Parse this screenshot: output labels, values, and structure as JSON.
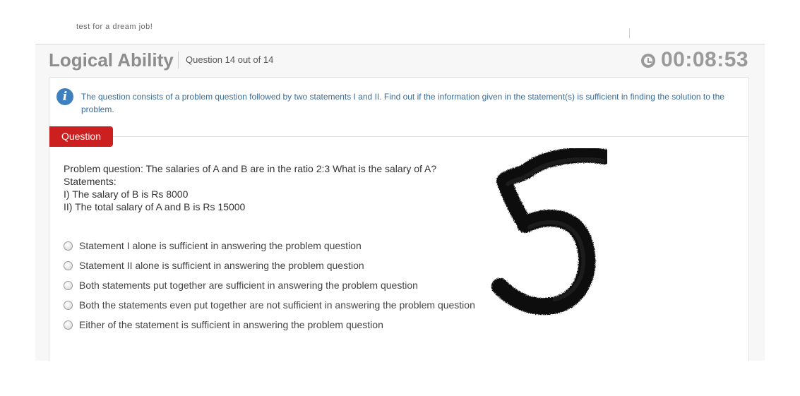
{
  "top_strip": {
    "cut_text": "test for a dream job!"
  },
  "header": {
    "section_title": "Logical Ability",
    "question_counter": "Question 14 out of 14",
    "timer": "00:08:53",
    "clock_icon": "clock-icon"
  },
  "info": {
    "icon": "info-icon",
    "text": "The question consists of a problem question followed by two statements I and II. Find out if the information given in the statement(s) is sufficient in finding the solution to the problem."
  },
  "tab": {
    "label": "Question",
    "color": "#cc1f1f"
  },
  "question": {
    "lines": [
      "Problem question: The salaries of A and B are in the ratio 2:3 What is the salary of A?",
      "Statements:",
      "I) The salary of B is Rs 8000",
      "II) The total salary of A and B is Rs 15000"
    ]
  },
  "options": [
    {
      "label": "Statement I alone is sufficient in answering the problem question",
      "selected": false
    },
    {
      "label": "Statement II alone is sufficient in answering the problem question",
      "selected": false
    },
    {
      "label": "Both statements put together are sufficient in answering the problem question",
      "selected": false
    },
    {
      "label": "Both the statements even put together are not sufficient in answering the problem question",
      "selected": false
    },
    {
      "label": "Either of the statement is sufficient in answering the problem question",
      "selected": false
    }
  ],
  "overlay": {
    "handwritten_digit": "5"
  },
  "colors": {
    "accent_red": "#cc1f1f",
    "info_blue": "#3d7fbf",
    "info_text": "#3a6c98",
    "title_gray": "#8d8d8d"
  }
}
